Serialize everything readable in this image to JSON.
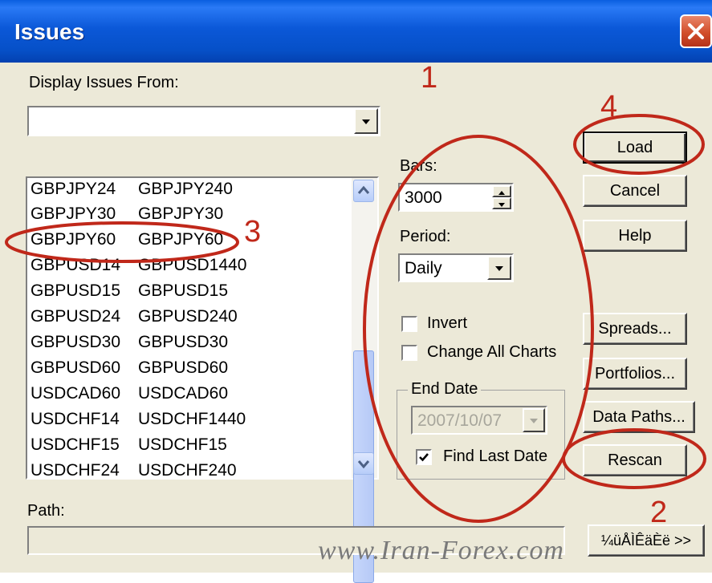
{
  "window": {
    "title": "Issues"
  },
  "display_from": {
    "label": "Display Issues From:",
    "value": ""
  },
  "issues_list": [
    {
      "c1": "GBPJPY24",
      "c2": "GBPJPY240"
    },
    {
      "c1": "GBPJPY30",
      "c2": "GBPJPY30"
    },
    {
      "c1": "GBPJPY60",
      "c2": "GBPJPY60"
    },
    {
      "c1": "GBPUSD14",
      "c2": "GBPUSD1440"
    },
    {
      "c1": "GBPUSD15",
      "c2": "GBPUSD15"
    },
    {
      "c1": "GBPUSD24",
      "c2": "GBPUSD240"
    },
    {
      "c1": "GBPUSD30",
      "c2": "GBPUSD30"
    },
    {
      "c1": "GBPUSD60",
      "c2": "GBPUSD60"
    },
    {
      "c1": "USDCAD60",
      "c2": "USDCAD60"
    },
    {
      "c1": "USDCHF14",
      "c2": "USDCHF1440"
    },
    {
      "c1": "USDCHF15",
      "c2": "USDCHF15"
    },
    {
      "c1": "USDCHF24",
      "c2": "USDCHF240"
    }
  ],
  "bars": {
    "label": "Bars:",
    "value": "3000"
  },
  "period": {
    "label": "Period:",
    "value": "Daily"
  },
  "invert": {
    "label": "Invert",
    "checked": false
  },
  "change_all": {
    "label": "Change All Charts",
    "checked": false
  },
  "end_date": {
    "group_label": "End Date",
    "value": "2007/10/07",
    "find_last_label": "Find Last Date",
    "find_last_checked": true
  },
  "buttons": {
    "load": "Load",
    "cancel": "Cancel",
    "help": "Help",
    "spreads": "Spreads...",
    "portfolios": "Portfolios...",
    "data_paths": "Data Paths...",
    "rescan": "Rescan",
    "more": "¼üÅÌÊäÈë >>"
  },
  "path": {
    "label": "Path:",
    "value": ""
  },
  "annotations": {
    "a1": "1",
    "a2": "2",
    "a3": "3",
    "a4": "4"
  },
  "watermark": "www.Iran-Forex.com",
  "colors": {
    "titlebar": "#0b58d8",
    "dialog_bg": "#ece9d8",
    "annotation": "#c0281a"
  }
}
